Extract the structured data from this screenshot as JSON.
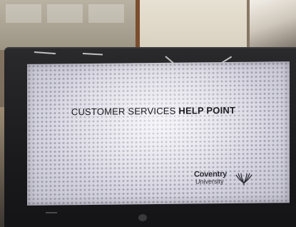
{
  "screen": {
    "headline_regular": "CUSTOMER SERVICES",
    "headline_bold": "HELP POINT"
  },
  "logo": {
    "line1": "Coventry",
    "line2": "University"
  },
  "icons": {
    "logo_emblem": "eagle-emblem-icon",
    "monitor_brand": "hp-logo-icon"
  },
  "colors": {
    "bezel": "#1b1b1d",
    "screen_background": "#dcdae4",
    "text": "#1b1b1f"
  }
}
